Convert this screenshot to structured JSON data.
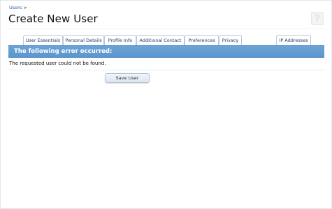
{
  "breadcrumb": {
    "link": "Users",
    "separator": ">"
  },
  "page_title": "Create New User",
  "help_icon": {
    "name": "help-icon",
    "glyph": "?"
  },
  "tabs": [
    {
      "label": "User Essentials"
    },
    {
      "label": "Personal Details"
    },
    {
      "label": "Profile Info"
    },
    {
      "label": "Additional Contact"
    },
    {
      "label": "Preferences"
    },
    {
      "label": "Privacy"
    },
    {
      "label": "IP Addresses"
    }
  ],
  "error": {
    "heading": "The following error occurred:",
    "message": "The requested user could not be found."
  },
  "actions": {
    "save_label": "Save User"
  },
  "colors": {
    "accent": "#5b95cc",
    "link": "#2b5a99",
    "tab_text": "#1d3c66"
  }
}
